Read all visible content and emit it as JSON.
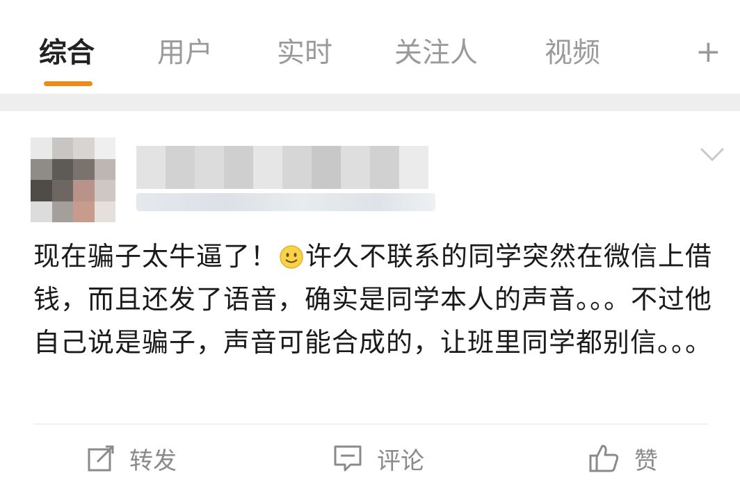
{
  "tabs": [
    {
      "label": "综合",
      "active": true
    },
    {
      "label": "用户",
      "active": false
    },
    {
      "label": "实时",
      "active": false
    },
    {
      "label": "关注人",
      "active": false
    },
    {
      "label": "视频",
      "active": false
    }
  ],
  "add_tab_label": "+",
  "colors": {
    "accent": "#f08a1b",
    "text": "#1a1a1a",
    "muted": "#8a8a8a"
  },
  "post": {
    "text_part1": "现在骗子太牛逼了！",
    "emoji": "smiley-icon",
    "text_part2": "许久不联系的同学突然在微信上借钱，而且还发了语音，确实是同学本人的声音。。。不过他自己说是骗子，声音可能合成的，让班里同学都别信。。。"
  },
  "actions": {
    "repost_label": "转发",
    "comment_label": "评论",
    "like_label": "赞"
  }
}
